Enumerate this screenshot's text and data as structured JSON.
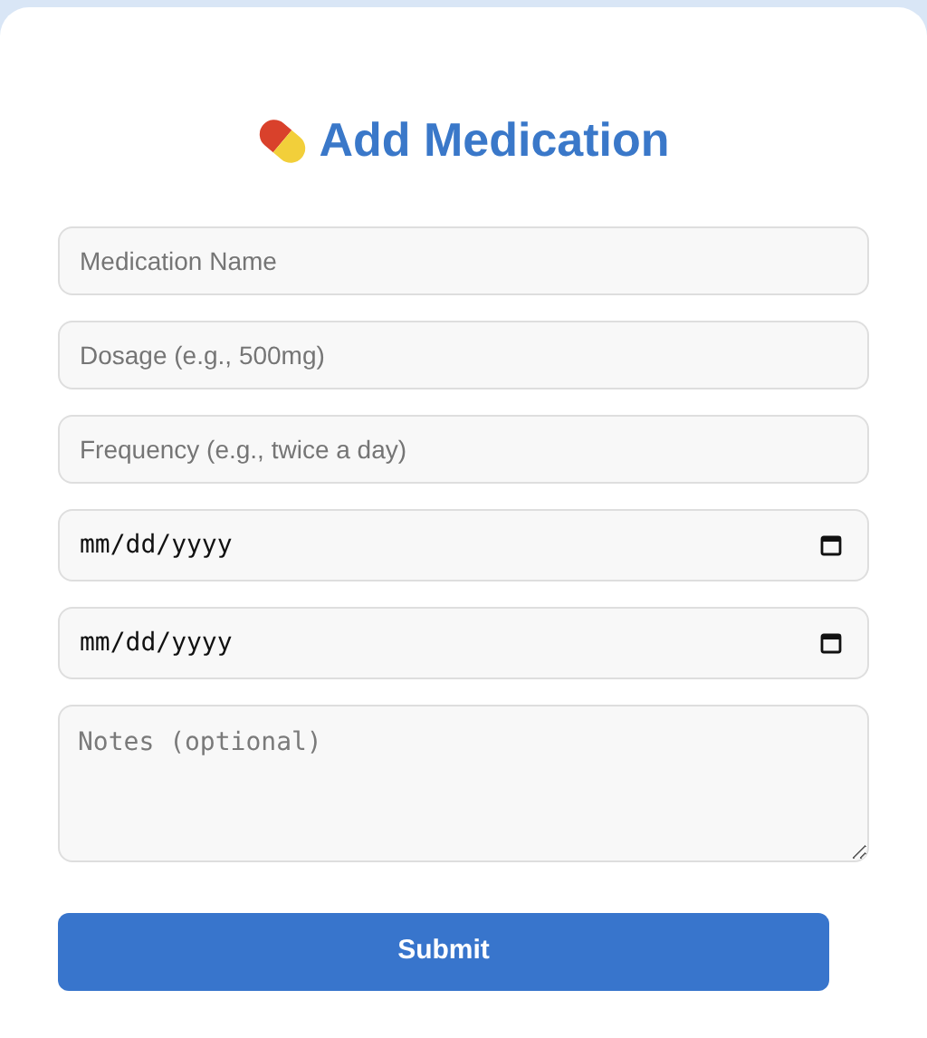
{
  "title": "Add Medication",
  "fields": [
    {
      "kind": "text",
      "placeholder": "Medication Name"
    },
    {
      "kind": "text",
      "placeholder": "Dosage (e.g., 500mg)"
    },
    {
      "kind": "text",
      "placeholder": "Frequency (e.g., twice a day)"
    },
    {
      "kind": "date",
      "value": "mm/dd/yyyy"
    },
    {
      "kind": "date",
      "value": "mm/dd/yyyy"
    },
    {
      "kind": "textarea",
      "placeholder": "Notes (optional)"
    }
  ],
  "submit": "Submit"
}
